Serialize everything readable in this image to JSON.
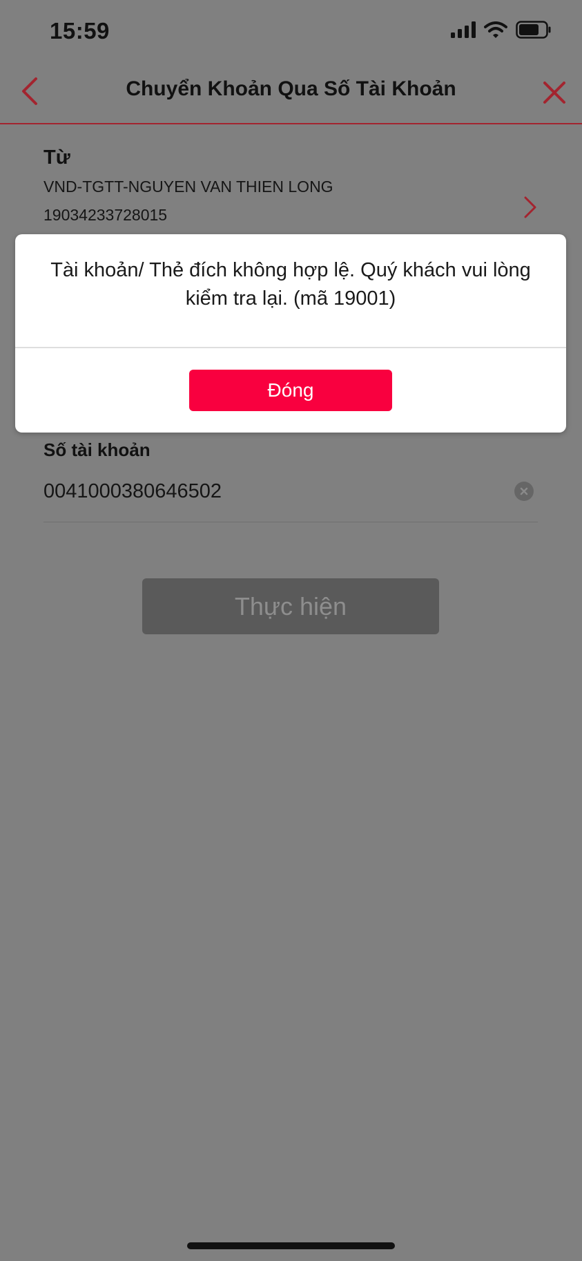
{
  "status_bar": {
    "time": "15:59",
    "icons": [
      "cellular-signal-icon",
      "wifi-icon",
      "battery-icon"
    ]
  },
  "nav": {
    "title": "Chuyển Khoản Qua Số Tài Khoản",
    "back_icon": "chevron-left-icon",
    "close_icon": "close-icon"
  },
  "from": {
    "label": "Từ",
    "account_name": "VND-TGTT-NGUYEN VAN THIEN LONG",
    "account_number": "19034233728015"
  },
  "account": {
    "label": "Số tài khoản",
    "value": "0041000380646502"
  },
  "submit": {
    "label": "Thực hiện"
  },
  "dialog": {
    "message": "Tài khoản/ Thẻ đích không hợp lệ. Quý khách vui lòng kiểm tra lại. (mã 19001)",
    "button_label": "Đóng"
  },
  "colors": {
    "overlay_background": "#808080",
    "accent": "#a3242f",
    "dialog_button": "#f9003f",
    "disabled_button": "#5a5a5a"
  }
}
